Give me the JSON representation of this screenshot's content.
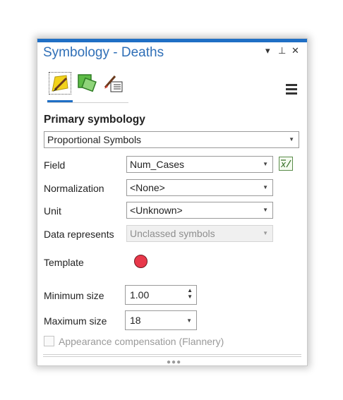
{
  "pane": {
    "title": "Symbology - Deaths",
    "window_buttons": {
      "dropdown": "▾",
      "pin": "⊥",
      "close": "✕"
    },
    "tabs": [
      {
        "icon": "primary-symbology-icon",
        "selected": true
      },
      {
        "icon": "vary-symbology-icon",
        "selected": false
      },
      {
        "icon": "symbol-layer-drawing-icon",
        "selected": false
      }
    ],
    "menu_icon": "hamburger-menu-icon"
  },
  "primary": {
    "heading": "Primary symbology",
    "method": "Proportional Symbols"
  },
  "form": {
    "field_label": "Field",
    "field_value": "Num_Cases",
    "normalization_label": "Normalization",
    "normalization_value": "<None>",
    "unit_label": "Unit",
    "unit_value": "<Unknown>",
    "data_represents_label": "Data represents",
    "data_represents_value": "Unclassed symbols",
    "template_label": "Template",
    "template_color": "#e8384a",
    "min_size_label": "Minimum size",
    "min_size_value": "1.00",
    "max_size_label": "Maximum size",
    "max_size_value": "18",
    "appearance_label": "Appearance compensation (Flannery)",
    "appearance_checked": false
  },
  "colors": {
    "accent": "#1f6fc5",
    "title_text": "#2f6fb7"
  }
}
